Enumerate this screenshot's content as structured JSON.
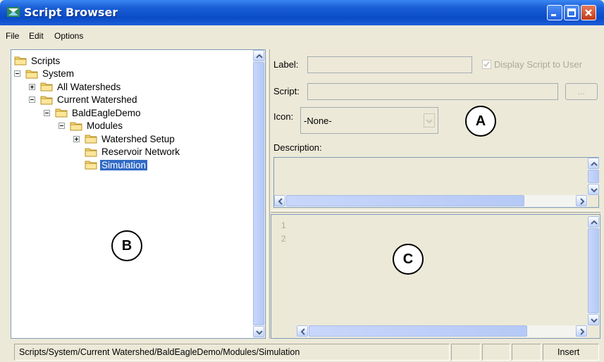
{
  "window": {
    "title": "Script Browser"
  },
  "menu": {
    "items": [
      "File",
      "Edit",
      "Options"
    ]
  },
  "tree": {
    "items": [
      {
        "label": "Scripts",
        "level": 0,
        "expander": "none",
        "selected": false
      },
      {
        "label": "System",
        "level": 0,
        "expander": "minus",
        "selected": false
      },
      {
        "label": "All Watersheds",
        "level": 1,
        "expander": "plus",
        "selected": false
      },
      {
        "label": "Current Watershed",
        "level": 1,
        "expander": "minus",
        "selected": false
      },
      {
        "label": "BaldEagleDemo",
        "level": 2,
        "expander": "minus",
        "selected": false
      },
      {
        "label": "Modules",
        "level": 3,
        "expander": "minus",
        "selected": false
      },
      {
        "label": "Watershed Setup",
        "level": 4,
        "expander": "plus",
        "selected": false
      },
      {
        "label": "Reservoir Network",
        "level": 4,
        "expander": "none",
        "selected": false
      },
      {
        "label": "Simulation",
        "level": 4,
        "expander": "none",
        "selected": true
      }
    ]
  },
  "props": {
    "label_caption": "Label:",
    "label_value": "",
    "display_checkbox_label": "Display Script to User",
    "display_checked": true,
    "script_caption": "Script:",
    "script_value": "",
    "browse_label": "...",
    "icon_caption": "Icon:",
    "icon_value": "-None-",
    "description_caption": "Description:",
    "description_value": ""
  },
  "editor": {
    "line_numbers": [
      "1",
      "2"
    ],
    "content": ""
  },
  "callouts": {
    "a": "A",
    "b": "B",
    "c": "C"
  },
  "status": {
    "path": "Scripts/System/Current Watershed/BaldEagleDemo/Modules/Simulation",
    "cell1": "",
    "cell2": "",
    "cell3": "",
    "mode": "Insert"
  },
  "colors": {
    "titlebar": "#0a4bc6",
    "selection": "#316ac5",
    "window_bg": "#ece9d8",
    "folder": "#f5d76e"
  }
}
